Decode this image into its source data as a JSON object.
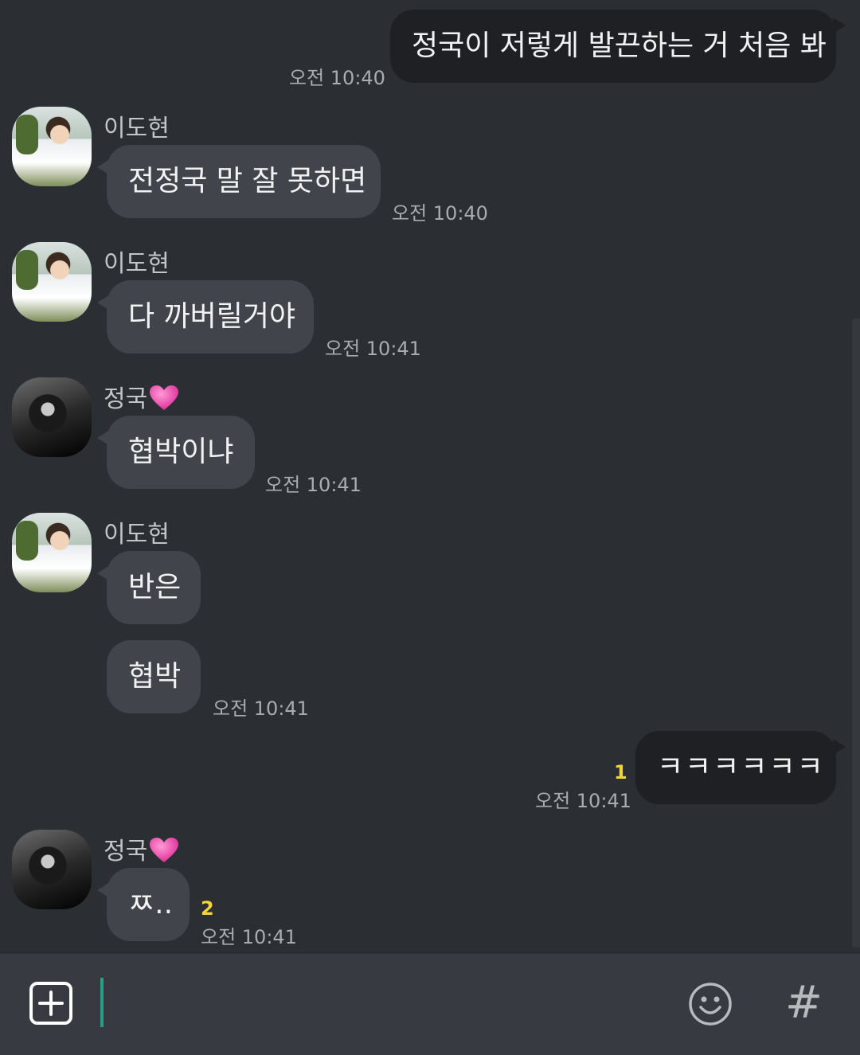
{
  "colors": {
    "bg": "#2b2e33",
    "incoming_bubble": "#41444a",
    "outgoing_bubble": "#1e2023",
    "unread": "#f2d43a",
    "caret": "#27a08a"
  },
  "messages": [
    {
      "text": "정국이 저렇게 발끈하는 거 처음 봐",
      "time": "오전 10:40"
    },
    {
      "sender": "이도현",
      "text": "전정국 말 잘 못하면",
      "time": "오전 10:40"
    },
    {
      "sender": "이도현",
      "text": "다 까버릴거야",
      "time": "오전 10:41"
    },
    {
      "sender": "정국",
      "text": "협박이냐",
      "time": "오전 10:41"
    },
    {
      "sender": "이도현",
      "text": "반은",
      "text2": "협박",
      "time": "오전 10:41"
    },
    {
      "text": "ㅋㅋㅋㅋㅋㅋ",
      "unread": "1",
      "time": "오전 10:41"
    },
    {
      "sender": "정국",
      "text": "ㅉ..",
      "unread": "2",
      "time": "오전 10:41"
    }
  ],
  "input": {
    "plus_icon": "plus-square-icon",
    "emoji_icon": "smiley-icon",
    "hash_label": "#"
  }
}
